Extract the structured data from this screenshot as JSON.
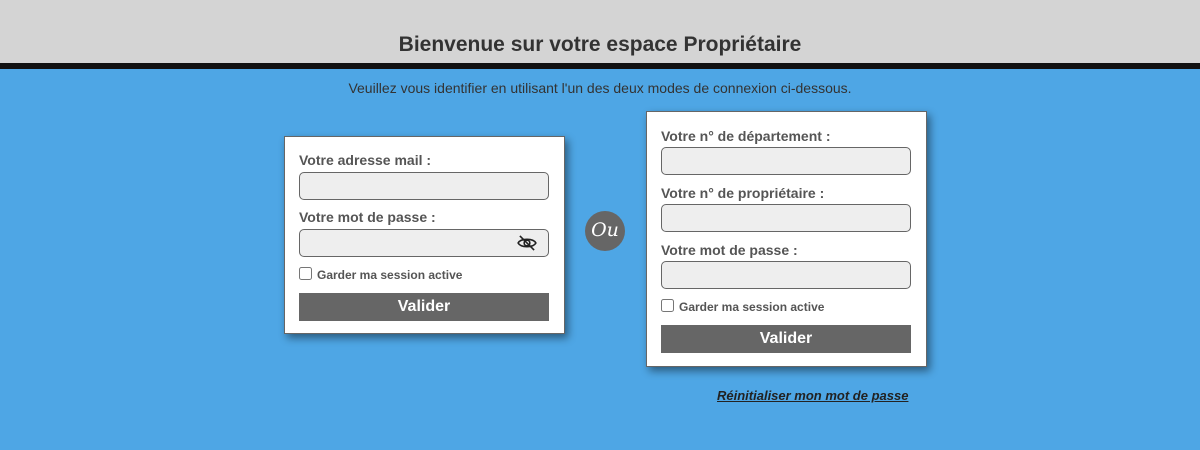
{
  "header": {
    "title": "Bienvenue sur votre espace Propriétaire"
  },
  "intro": "Veuillez vous identifier en utilisant l'un des deux modes de connexion ci-dessous.",
  "separator": "Ou",
  "email_form": {
    "email_label": "Votre adresse mail :",
    "email_value": "",
    "password_label": "Votre mot de passe :",
    "password_value": "",
    "toggle_icon": "eye-slash-icon",
    "remember_label": "Garder ma session active",
    "remember_checked": false,
    "submit_label": "Valider"
  },
  "owner_form": {
    "department_label": "Votre n° de département :",
    "department_value": "",
    "owner_label": "Votre n° de propriétaire :",
    "owner_value": "",
    "password_label": "Votre mot de passe :",
    "password_value": "",
    "remember_label": "Garder ma session active",
    "remember_checked": false,
    "submit_label": "Valider"
  },
  "reset_link": "Réinitialiser mon mot de passe",
  "colors": {
    "background": "#4ea6e5",
    "header": "#d4d4d4",
    "button": "#666666",
    "input": "#eeeeee"
  }
}
